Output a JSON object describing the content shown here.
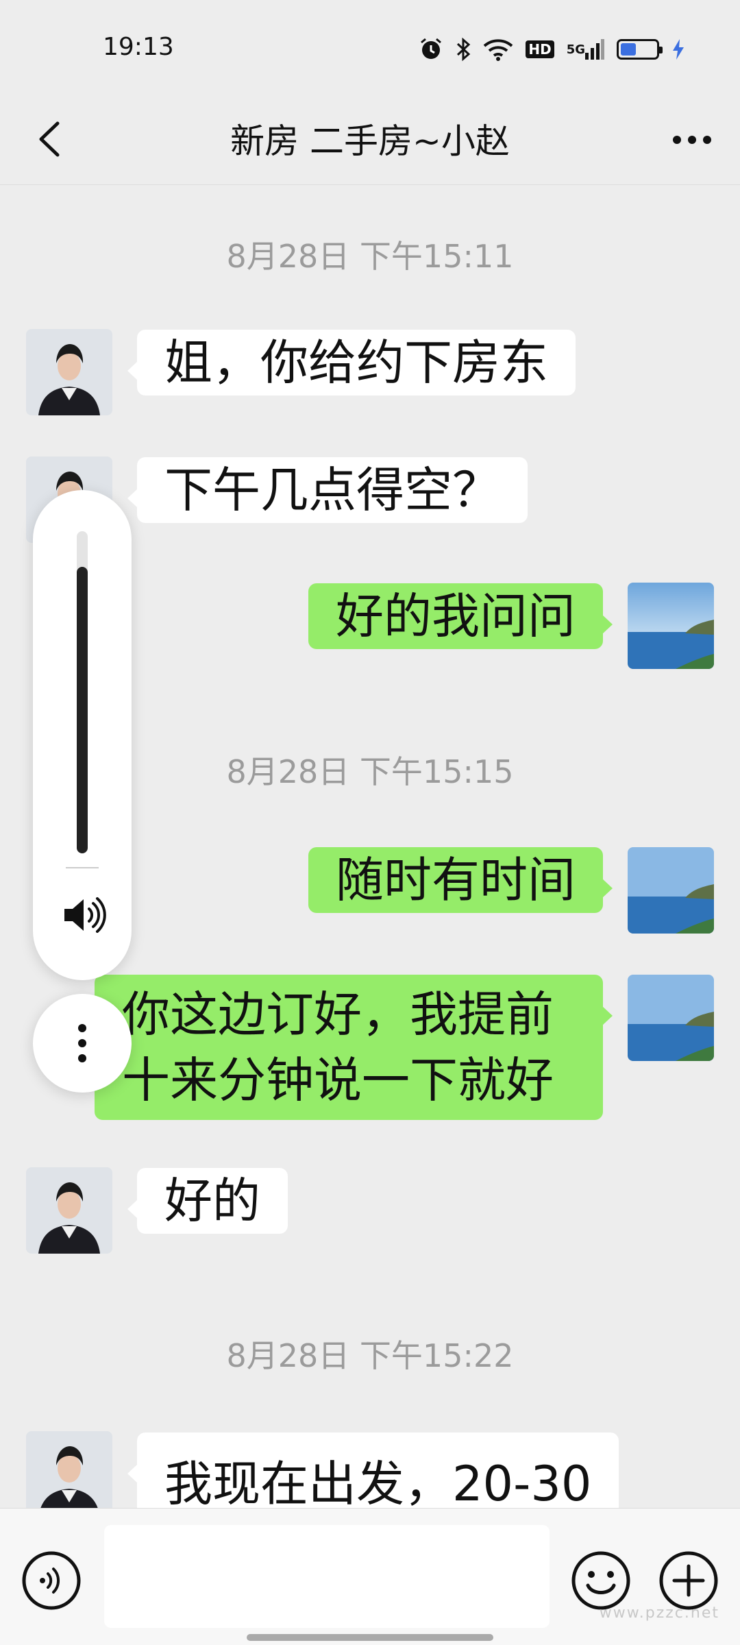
{
  "status_bar": {
    "time": "19:13",
    "network": "5G",
    "hd": "HD",
    "battery_level": 0.5,
    "icons": [
      "alarm-icon",
      "bluetooth-icon",
      "wifi-icon",
      "hd-icon",
      "signal-icon",
      "battery-icon",
      "charging-icon"
    ]
  },
  "header": {
    "title": "新房 二手房~小赵",
    "back_icon": "chevron-left-icon",
    "more_icon": "more-icon"
  },
  "messages": [
    {
      "type": "timestamp",
      "text": "8月28日 下午15:11"
    },
    {
      "type": "in",
      "text": "姐，你给约下房东"
    },
    {
      "type": "in",
      "text": "下午几点得空？"
    },
    {
      "type": "out",
      "text": "好的我问问"
    },
    {
      "type": "timestamp",
      "text": "8月28日 下午15:15"
    },
    {
      "type": "out",
      "text": "随时有时间"
    },
    {
      "type": "out",
      "lines": [
        "你这边订好，我提前",
        "十来分钟说一下就好"
      ]
    },
    {
      "type": "in",
      "text": "好的"
    },
    {
      "type": "timestamp",
      "text": "8月28日 下午15:22"
    },
    {
      "type": "in",
      "text": "我现在出发，20-30"
    }
  ],
  "volume_overlay": {
    "level": 0.89,
    "speaker_icon": "speaker-icon",
    "more_icon": "vertical-dots-icon"
  },
  "input_bar": {
    "value": "",
    "voice_icon": "voice-icon",
    "emoji_icon": "emoji-icon",
    "plus_icon": "plus-icon"
  },
  "colors": {
    "background": "#ededed",
    "incoming_bubble": "#ffffff",
    "outgoing_bubble": "#95ec69",
    "timestamp_text": "#9b9b9b"
  },
  "watermark": "www.pzzc.net"
}
